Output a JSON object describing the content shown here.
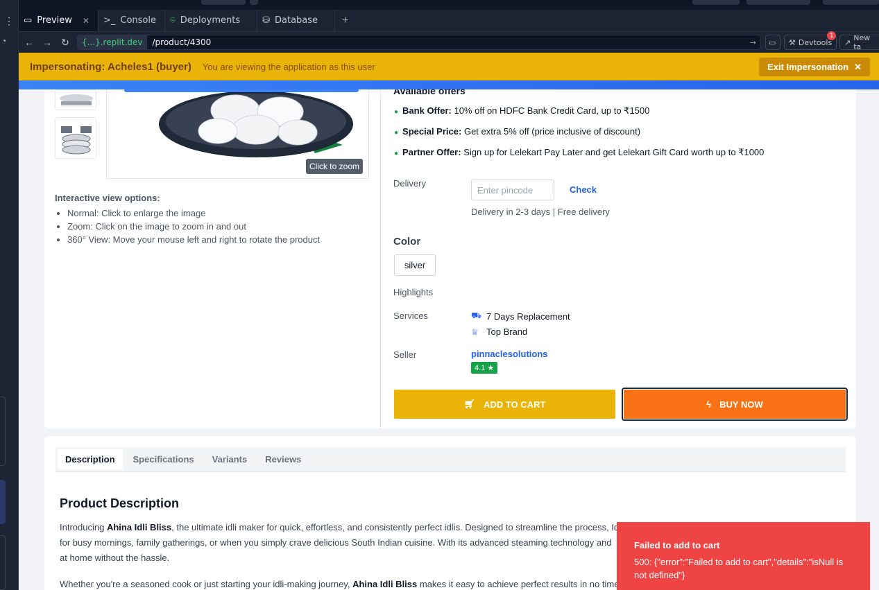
{
  "workspace": {
    "tabs": [
      {
        "label": "Preview",
        "icon": "monitor-icon"
      },
      {
        "label": "Console",
        "icon": "terminal-icon"
      },
      {
        "label": "Deployments",
        "icon": "deploy-icon"
      },
      {
        "label": "Database",
        "icon": "database-icon"
      }
    ],
    "url_host": "{...}.replit.dev",
    "url_path": "/product/4300",
    "devtools_label": "Devtools",
    "devtools_badge": "1",
    "new_tab_label": "New ta"
  },
  "impersonation": {
    "title": "Impersonating: Acheles1 (buyer)",
    "subtitle": "You are viewing the application as this user",
    "exit_label": "Exit Impersonation"
  },
  "gallery": {
    "zoom_hint": "Click to zoom",
    "options_title": "Interactive view options:",
    "options": [
      "Normal: Click to enlarge the image",
      "Zoom: Click on the image to zoom in and out",
      "360° View: Move your mouse left and right to rotate the product"
    ]
  },
  "offers": {
    "title": "Available offers",
    "items": [
      {
        "name": "Bank Offer:",
        "text": "10% off on HDFC Bank Credit Card, up to ₹1500"
      },
      {
        "name": "Special Price:",
        "text": "Get extra 5% off (price inclusive of discount)"
      },
      {
        "name": "Partner Offer:",
        "text": "Sign up for Lelekart Pay Later and get Lelekart Gift Card worth up to ₹1000"
      }
    ]
  },
  "delivery": {
    "label": "Delivery",
    "placeholder": "Enter pincode",
    "check_label": "Check",
    "info": "Delivery in 2-3 days | Free delivery"
  },
  "color": {
    "title": "Color",
    "selected": "silver"
  },
  "highlights_label": "Highlights",
  "services": {
    "label": "Services",
    "items": [
      "7 Days Replacement",
      "Top Brand"
    ]
  },
  "seller": {
    "label": "Seller",
    "name": "pinnaclesolutions",
    "rating": "4.1 ★"
  },
  "actions": {
    "add_to_cart": "ADD TO CART",
    "buy_now": "BUY NOW"
  },
  "detail_tabs": [
    "Description",
    "Specifications",
    "Variants",
    "Reviews"
  ],
  "description": {
    "title": "Product Description",
    "p1_pre": "Introducing ",
    "p1_bold": "Ahina Idli Bliss",
    "p1_post": ", the ultimate idli maker for quick, effortless, and consistently perfect idlis. Designed to streamline the process, Id",
    "p1_line2": "for busy mornings, family gatherings, or when you simply crave delicious South Indian cuisine. With its advanced steaming technology and",
    "p1_line3": "at home without the hassle.",
    "p2_pre": "Whether you're a seasoned cook or just starting your idli-making journey, ",
    "p2_bold": "Ahina Idli Bliss",
    "p2_post": " makes it easy to achieve perfect results in no time"
  },
  "toast": {
    "title": "Failed to add to cart",
    "message": "500: {\"error\":\"Failed to add to cart\",\"details\":\"isNull is not defined\"}"
  },
  "colors": {
    "impersonation": "#eab308",
    "buy_now": "#f97316",
    "toast": "#ef4444",
    "link": "#2563eb"
  }
}
